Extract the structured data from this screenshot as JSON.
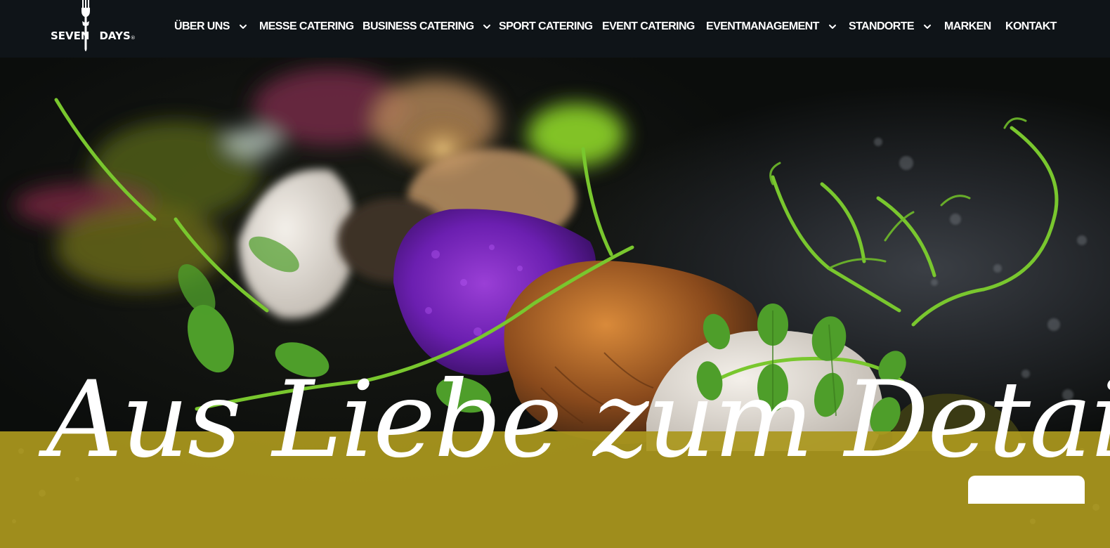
{
  "brand": {
    "name_left": "SEVEN",
    "name_right": "DAYS",
    "registered": "®"
  },
  "nav": {
    "items": [
      {
        "label": "ÜBER UNS",
        "has_dropdown": true
      },
      {
        "label": "MESSE CATERING",
        "has_dropdown": false
      },
      {
        "label": "BUSINESS CATERING",
        "has_dropdown": true
      },
      {
        "label": "SPORT CATERING",
        "has_dropdown": false
      },
      {
        "label": "EVENT CATERING",
        "has_dropdown": false
      },
      {
        "label": "EVENTMANAGEMENT",
        "has_dropdown": true
      },
      {
        "label": "STANDORTE",
        "has_dropdown": true
      },
      {
        "label": "MARKEN",
        "has_dropdown": false
      },
      {
        "label": "KONTAKT",
        "has_dropdown": false
      }
    ]
  },
  "hero": {
    "tagline": "Aus Liebe zum Detail"
  },
  "colors": {
    "header_bg": "#0f1418",
    "banner": "#ab981e",
    "text": "#ffffff"
  }
}
